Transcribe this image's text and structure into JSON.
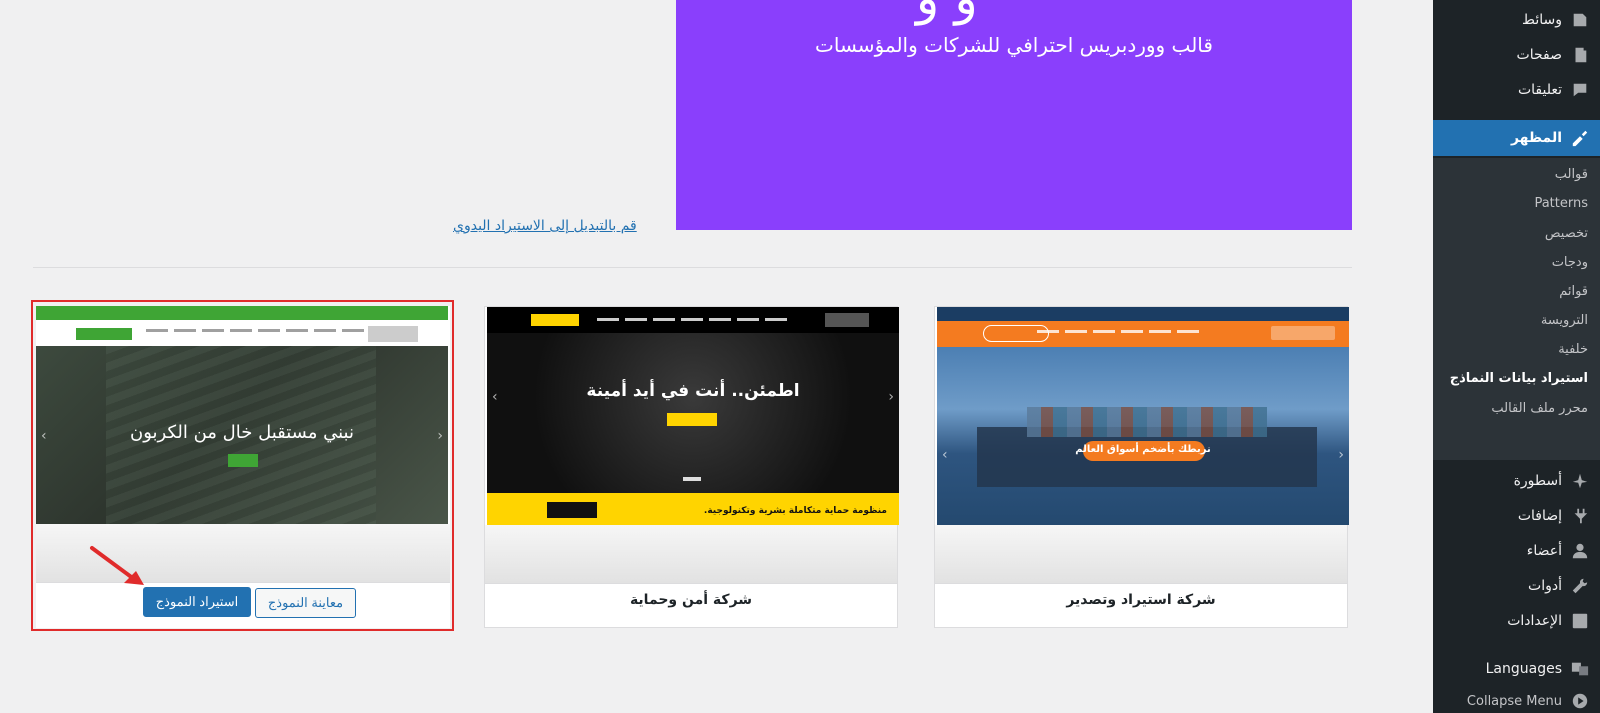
{
  "sidebar": {
    "media": "وسائط",
    "pages": "صفحات",
    "comments": "تعليقات",
    "appearance": "المظهر",
    "submenu": [
      "قوالب",
      "Patterns",
      "تخصيص",
      "ودجات",
      "قوائم",
      "الترويسة",
      "خلفية",
      "استيراد بيانات النماذج",
      "محرر ملف القالب"
    ],
    "active_submenu_index": 7,
    "ostoura": "أسطورة",
    "plugins": "إضافات",
    "users": "أعضاء",
    "tools": "أدوات",
    "settings": "الإعدادات",
    "languages": "Languages",
    "collapse": "Collapse Menu"
  },
  "hero": {
    "subtitle": "قالب ووردبريس احترافي للشركات والمؤسسات",
    "background_color": "#8a3ffc"
  },
  "manual_import_link": "قم بالتبديل إلى الاستيراد اليدوي",
  "demos": [
    {
      "title": "شركة استيراد وتصدير",
      "slide_caption": "نربطك بأضخم أسواق العالم",
      "accent": "#f47b20"
    },
    {
      "title": "شركة أمن وحماية",
      "slide_heading": "اطمئن.. أنت في أيد أمينة",
      "banner_text": "منظومة حماية متكاملة بشرية وتكنولوجية.",
      "accent": "#ffd400"
    },
    {
      "slide_heading": "نبني مستقبل خال من الكربون",
      "accent": "#3fa535",
      "import_button": "استيراد النموذج",
      "preview_button": "معاينة النموذج"
    }
  ],
  "icons": {
    "media": "media-icon",
    "pages": "pages-icon",
    "comments": "comments-icon",
    "appearance": "paintbrush-icon",
    "ostoura": "logo-icon",
    "plugins": "plugin-icon",
    "users": "users-icon",
    "tools": "wrench-icon",
    "settings": "settings-icon",
    "languages": "translate-icon",
    "collapse": "collapse-icon"
  }
}
